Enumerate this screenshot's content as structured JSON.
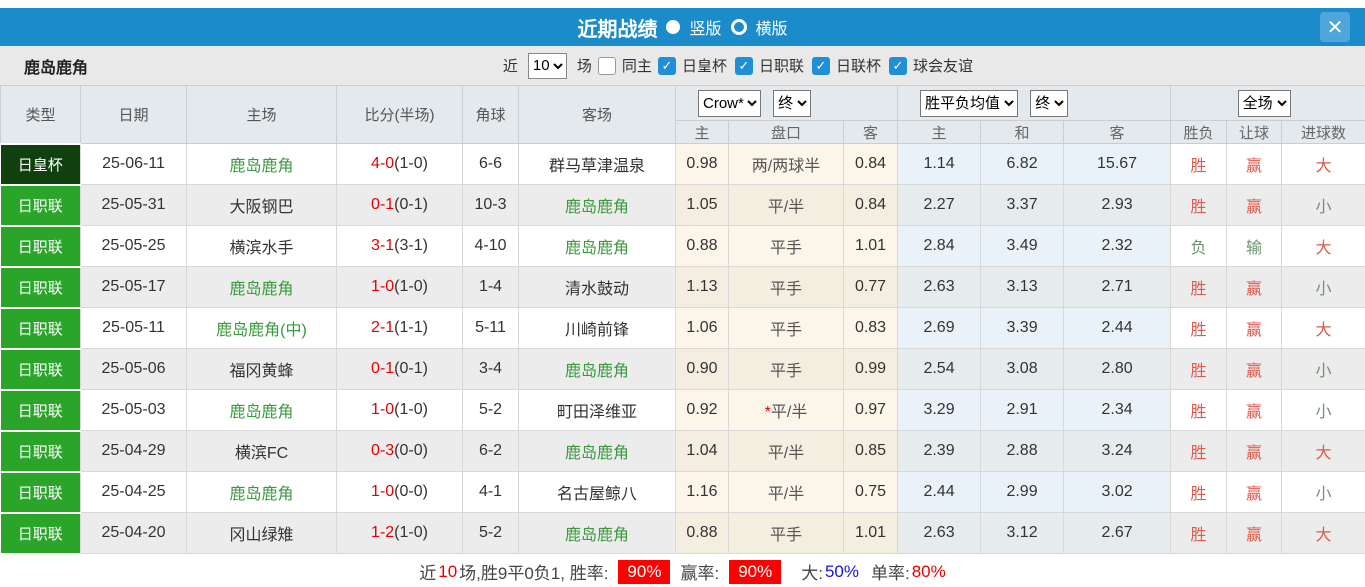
{
  "titlebar": {
    "title": "近期战绩",
    "radio_vertical": "竖版",
    "radio_horizontal": "横版",
    "close_label": "✕"
  },
  "filterbar": {
    "team": "鹿岛鹿角",
    "near_label": "近",
    "count_value": "10",
    "count_suffix": "场",
    "same_home_label": "同主",
    "leagues": [
      "日皇杯",
      "日职联",
      "日联杯",
      "球会友谊"
    ]
  },
  "table": {
    "selects": {
      "bookmaker": "Crow*",
      "handicap_time": "终",
      "avg": "胜平负均值",
      "avg_time": "终",
      "scope": "全场"
    },
    "col_headers": [
      "类型",
      "日期",
      "主场",
      "比分(半场)",
      "角球",
      "客场"
    ],
    "sub_headers": [
      "主",
      "盘口",
      "客",
      "主",
      "和",
      "客",
      "胜负",
      "让球",
      "进球数"
    ],
    "rows": [
      {
        "type": "日皇杯",
        "cup": true,
        "date": "25-06-11",
        "home": "鹿岛鹿角",
        "homeG": true,
        "ft": "4-0",
        "ht": "(1-0)",
        "corner": "6-6",
        "away": "群马草津温泉",
        "awayG": false,
        "ah": "0.98",
        "line": "两/两球半",
        "star": false,
        "aa": "0.84",
        "m1": "1.14",
        "m2": "6.82",
        "m3": "15.67",
        "r1": "胜",
        "r1c": "red",
        "r2": "赢",
        "r2c": "red",
        "r3": "大",
        "r3c": "red"
      },
      {
        "type": "日职联",
        "cup": false,
        "date": "25-05-31",
        "home": "大阪钢巴",
        "homeG": false,
        "ft": "0-1",
        "ht": "(0-1)",
        "corner": "10-3",
        "away": "鹿岛鹿角",
        "awayG": true,
        "ah": "1.05",
        "line": "平/半",
        "star": false,
        "aa": "0.84",
        "m1": "2.27",
        "m2": "3.37",
        "m3": "2.93",
        "r1": "胜",
        "r1c": "red",
        "r2": "赢",
        "r2c": "red",
        "r3": "小",
        "r3c": "green"
      },
      {
        "type": "日职联",
        "cup": false,
        "date": "25-05-25",
        "home": "横滨水手",
        "homeG": false,
        "ft": "3-1",
        "ht": "(3-1)",
        "corner": "4-10",
        "away": "鹿岛鹿角",
        "awayG": true,
        "ah": "0.88",
        "line": "平手",
        "star": false,
        "aa": "1.01",
        "m1": "2.84",
        "m2": "3.49",
        "m3": "2.32",
        "r1": "负",
        "r1c": "green",
        "r2": "输",
        "r2c": "green",
        "r3": "大",
        "r3c": "red"
      },
      {
        "type": "日职联",
        "cup": false,
        "date": "25-05-17",
        "home": "鹿岛鹿角",
        "homeG": true,
        "ft": "1-0",
        "ht": "(1-0)",
        "corner": "1-4",
        "away": "清水鼓动",
        "awayG": false,
        "ah": "1.13",
        "line": "平手",
        "star": false,
        "aa": "0.77",
        "m1": "2.63",
        "m2": "3.13",
        "m3": "2.71",
        "r1": "胜",
        "r1c": "red",
        "r2": "赢",
        "r2c": "red",
        "r3": "小",
        "r3c": "green"
      },
      {
        "type": "日职联",
        "cup": false,
        "date": "25-05-11",
        "home": "鹿岛鹿角(中)",
        "homeG": true,
        "ft": "2-1",
        "ht": "(1-1)",
        "corner": "5-11",
        "away": "川崎前锋",
        "awayG": false,
        "ah": "1.06",
        "line": "平手",
        "star": false,
        "aa": "0.83",
        "m1": "2.69",
        "m2": "3.39",
        "m3": "2.44",
        "r1": "胜",
        "r1c": "red",
        "r2": "赢",
        "r2c": "red",
        "r3": "大",
        "r3c": "red"
      },
      {
        "type": "日职联",
        "cup": false,
        "date": "25-05-06",
        "home": "福冈黄蜂",
        "homeG": false,
        "ft": "0-1",
        "ht": "(0-1)",
        "corner": "3-4",
        "away": "鹿岛鹿角",
        "awayG": true,
        "ah": "0.90",
        "line": "平手",
        "star": false,
        "aa": "0.99",
        "m1": "2.54",
        "m2": "3.08",
        "m3": "2.80",
        "r1": "胜",
        "r1c": "red",
        "r2": "赢",
        "r2c": "red",
        "r3": "小",
        "r3c": "green"
      },
      {
        "type": "日职联",
        "cup": false,
        "date": "25-05-03",
        "home": "鹿岛鹿角",
        "homeG": true,
        "ft": "1-0",
        "ht": "(1-0)",
        "corner": "5-2",
        "away": "町田泽维亚",
        "awayG": false,
        "ah": "0.92",
        "line": "平/半",
        "star": true,
        "aa": "0.97",
        "m1": "3.29",
        "m2": "2.91",
        "m3": "2.34",
        "r1": "胜",
        "r1c": "red",
        "r2": "赢",
        "r2c": "red",
        "r3": "小",
        "r3c": "green"
      },
      {
        "type": "日职联",
        "cup": false,
        "date": "25-04-29",
        "home": "横滨FC",
        "homeG": false,
        "ft": "0-3",
        "ht": "(0-0)",
        "corner": "6-2",
        "away": "鹿岛鹿角",
        "awayG": true,
        "ah": "1.04",
        "line": "平/半",
        "star": false,
        "aa": "0.85",
        "m1": "2.39",
        "m2": "2.88",
        "m3": "3.24",
        "r1": "胜",
        "r1c": "red",
        "r2": "赢",
        "r2c": "red",
        "r3": "大",
        "r3c": "red"
      },
      {
        "type": "日职联",
        "cup": false,
        "date": "25-04-25",
        "home": "鹿岛鹿角",
        "homeG": true,
        "ft": "1-0",
        "ht": "(0-0)",
        "corner": "4-1",
        "away": "名古屋鲸八",
        "awayG": false,
        "ah": "1.16",
        "line": "平/半",
        "star": false,
        "aa": "0.75",
        "m1": "2.44",
        "m2": "2.99",
        "m3": "3.02",
        "r1": "胜",
        "r1c": "red",
        "r2": "赢",
        "r2c": "red",
        "r3": "小",
        "r3c": "green"
      },
      {
        "type": "日职联",
        "cup": false,
        "date": "25-04-20",
        "home": "冈山绿雉",
        "homeG": false,
        "ft": "1-2",
        "ht": "(1-0)",
        "corner": "5-2",
        "away": "鹿岛鹿角",
        "awayG": true,
        "ah": "0.88",
        "line": "平手",
        "star": false,
        "aa": "1.01",
        "m1": "2.63",
        "m2": "3.12",
        "m3": "2.67",
        "r1": "胜",
        "r1c": "red",
        "r2": "赢",
        "r2c": "red",
        "r3": "大",
        "r3c": "red"
      }
    ]
  },
  "footer": {
    "near_label": "近",
    "count": "10",
    "summary": "场,胜9平0负1, 胜率:",
    "win_rate": "90%",
    "handicap_label": "赢率:",
    "handicap_rate": "90%",
    "big_label": "大:",
    "big_rate": "50%",
    "single_label": "单率:",
    "single_rate": "80%"
  },
  "colors": {
    "bar_blue": "#1b8bca",
    "league_green": "#2aa52a",
    "cup_green": "#11400f",
    "team_green": "#3a9a3c",
    "score_red": "#e60000",
    "win_red": "#e0594b",
    "lose_green": "#6f9470",
    "rate_box_red": "#fe0000",
    "rate_blue": "#1414e0"
  }
}
